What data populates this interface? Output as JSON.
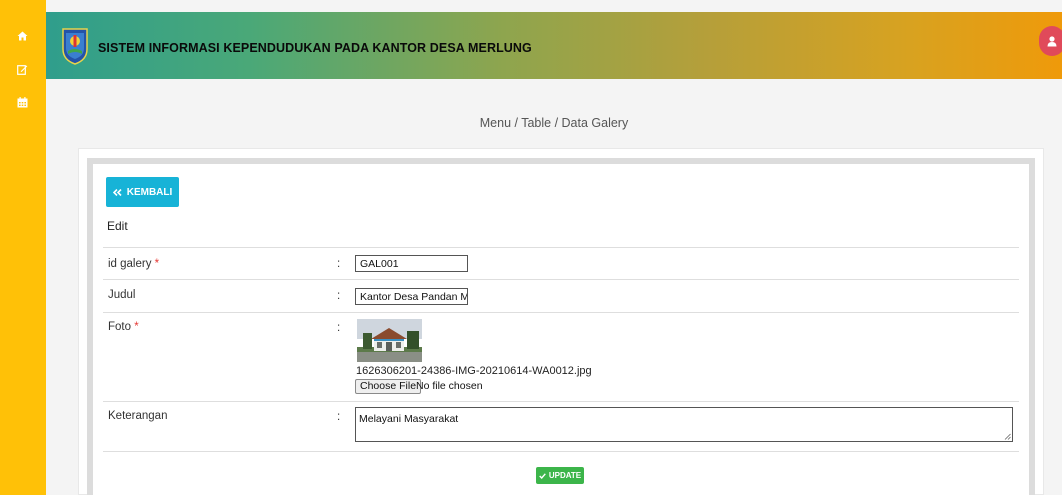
{
  "sidebar": {
    "icons": [
      "home-icon",
      "edit-icon",
      "calendar-icon"
    ]
  },
  "header": {
    "title": "SISTEM INFORMASI KEPENDUDUKAN PADA KANTOR DESA MERLUNG",
    "logo": "regency-crest-logo",
    "avatar_icon": "user-icon"
  },
  "breadcrumb": "Menu / Table / Data Galery",
  "actions": {
    "back_label": "KEMBALI",
    "back_icon": "double-chevron-left-icon",
    "update_label": "UPDATE",
    "update_icon": "check-icon"
  },
  "form": {
    "heading": "Edit",
    "separator": ":",
    "fields": [
      {
        "label": "id galery",
        "required": "*",
        "value": "GAL001"
      },
      {
        "label": "Judul",
        "value": "Kantor Desa Pandan Makmur"
      },
      {
        "label": "Foto",
        "required": "*",
        "current_file": "1626306201-24386-IMG-20210614-WA0012.jpg",
        "choose_label": "Choose File",
        "no_file_text": "No file chosen"
      },
      {
        "label": "Keterangan",
        "value": "Melayani Masyarakat"
      }
    ]
  },
  "colors": {
    "sidebar": "#ffc107",
    "back_button": "#17b3d7",
    "update_button": "#3cb54a",
    "avatar": "#e04a5a"
  }
}
